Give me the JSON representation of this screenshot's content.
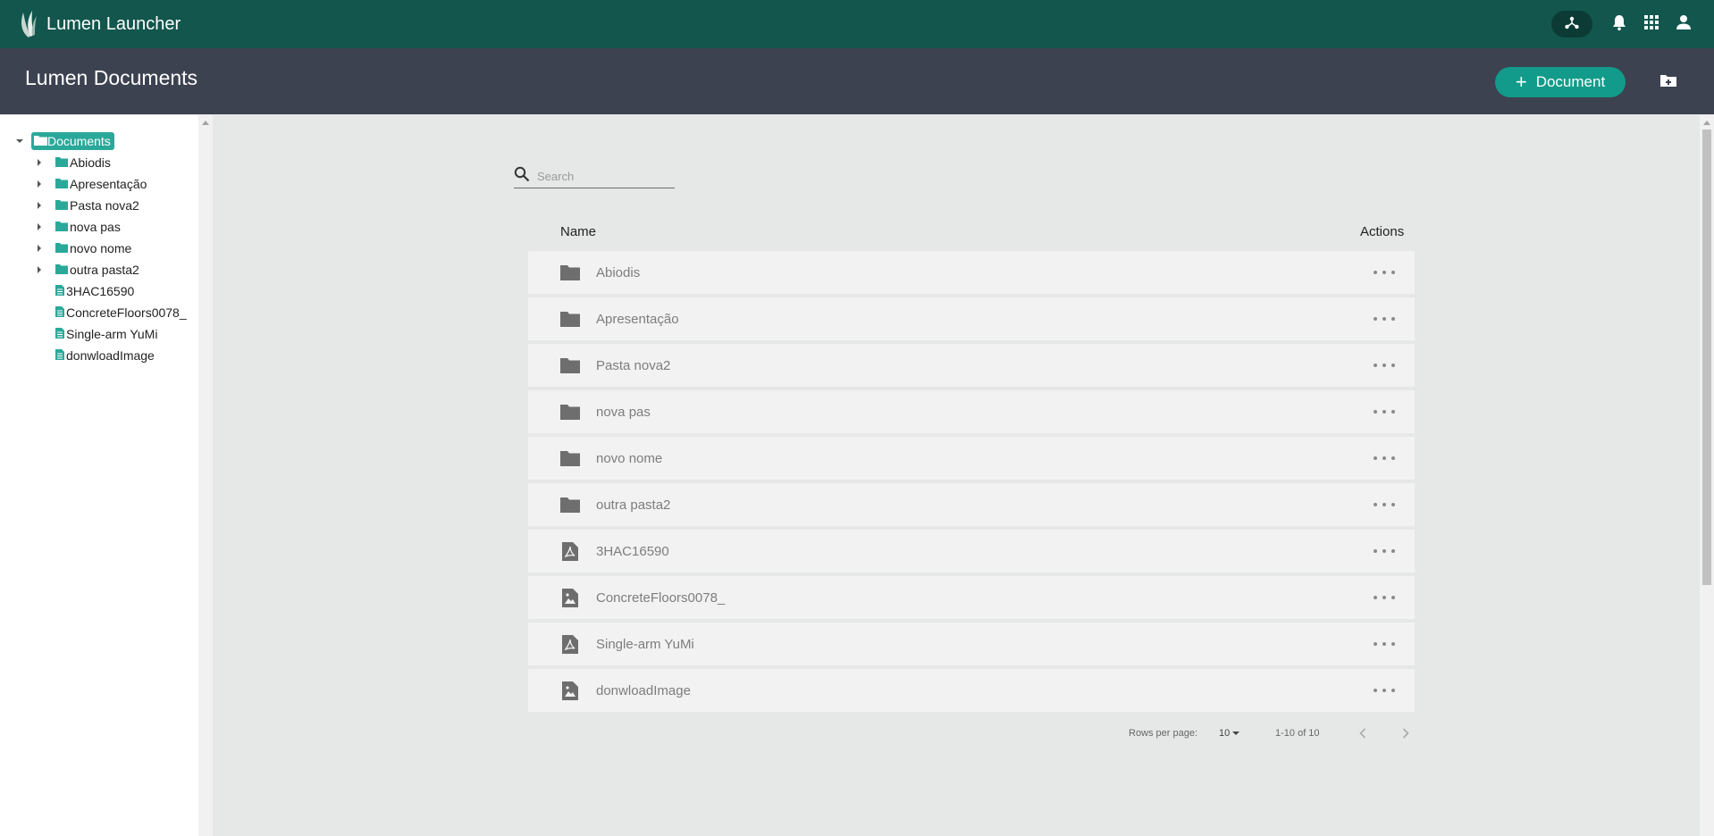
{
  "app": {
    "title": "Lumen Launcher"
  },
  "header": {
    "title": "Lumen Documents",
    "add_document_label": "Document"
  },
  "tree": {
    "root": "Documents",
    "items": [
      {
        "label": "Abiodis",
        "type": "folder"
      },
      {
        "label": "Apresentação",
        "type": "folder"
      },
      {
        "label": "Pasta nova2",
        "type": "folder"
      },
      {
        "label": "nova pas",
        "type": "folder"
      },
      {
        "label": "novo nome",
        "type": "folder"
      },
      {
        "label": "outra pasta2",
        "type": "folder"
      },
      {
        "label": "3HAC16590",
        "type": "file"
      },
      {
        "label": "ConcreteFloors0078_",
        "type": "file"
      },
      {
        "label": "Single-arm YuMi",
        "type": "file"
      },
      {
        "label": "donwloadImage",
        "type": "file"
      }
    ]
  },
  "search": {
    "placeholder": "Search"
  },
  "table": {
    "columns": {
      "name": "Name",
      "actions": "Actions"
    },
    "rows": [
      {
        "name": "Abiodis",
        "icon": "folder-icon"
      },
      {
        "name": "Apresentação",
        "icon": "folder-icon"
      },
      {
        "name": "Pasta nova2",
        "icon": "folder-icon"
      },
      {
        "name": "nova pas",
        "icon": "folder-icon"
      },
      {
        "name": "novo nome",
        "icon": "folder-icon"
      },
      {
        "name": "outra pasta2",
        "icon": "folder-icon"
      },
      {
        "name": "3HAC16590",
        "icon": "pdf-file-icon"
      },
      {
        "name": "ConcreteFloors0078_",
        "icon": "image-file-icon"
      },
      {
        "name": "Single-arm YuMi",
        "icon": "pdf-file-icon"
      },
      {
        "name": "donwloadImage",
        "icon": "image-file-icon"
      }
    ]
  },
  "pagination": {
    "rows_per_page_label": "Rows per page:",
    "rows_per_page": "10",
    "range": "1-10 of 10"
  },
  "colors": {
    "appbar": "#12564d",
    "header": "#3c4250",
    "accent": "#129b8a",
    "tree_icon": "#2aa99a"
  }
}
